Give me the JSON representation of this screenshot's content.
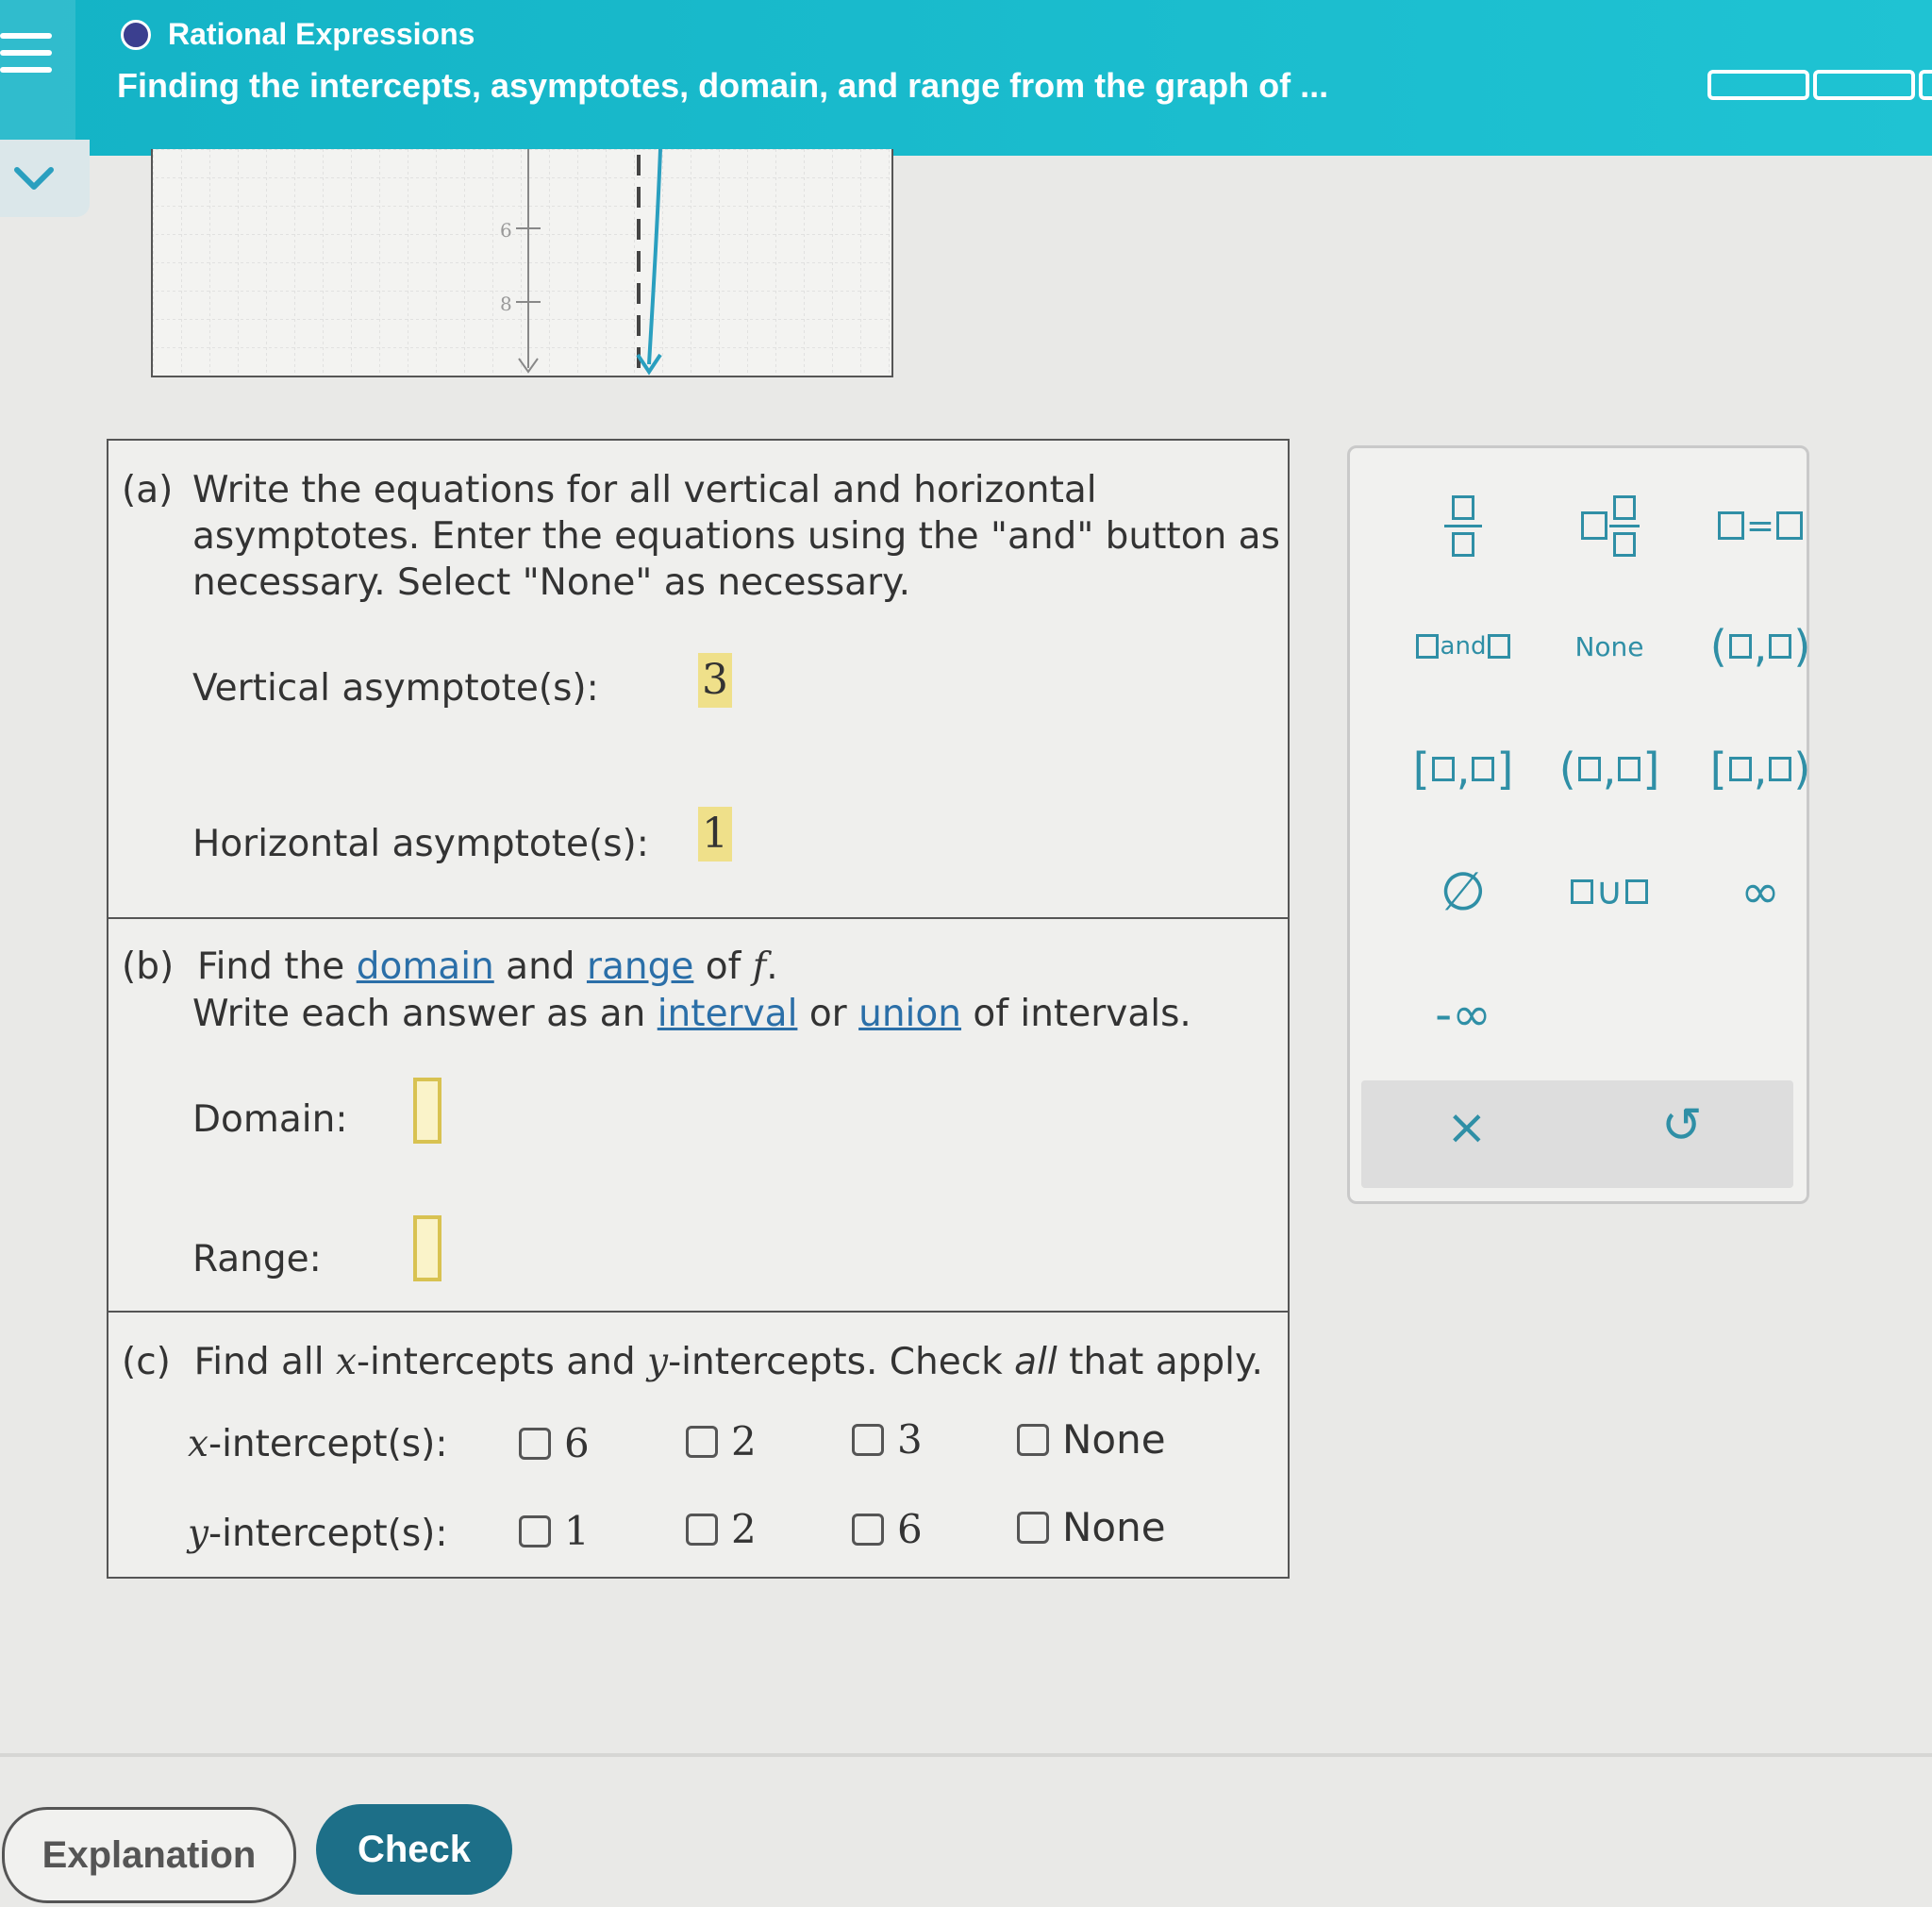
{
  "header": {
    "topic": "Rational Expressions",
    "title": "Finding the intercepts, asymptotes, domain, and range from the graph of ..."
  },
  "graph": {
    "y_tick_labels": [
      "6",
      "8"
    ]
  },
  "part_a": {
    "label": "(a)",
    "instructions_line1": "Write the equations for all vertical and horizontal",
    "instructions_line2": "asymptotes. Enter the equations using the \"and\" button as",
    "instructions_line3": "necessary. Select \"None\" as necessary.",
    "vertical_label": "Vertical asymptote(s):",
    "vertical_value": "3",
    "horizontal_label": "Horizontal asymptote(s):",
    "horizontal_value": "1"
  },
  "part_b": {
    "label": "(b)",
    "find_text": "Find the",
    "domain_link": "domain",
    "and_text": "and",
    "range_link": "range",
    "of_text": "of",
    "f_symbol": "f",
    "period": ".",
    "write_text": "Write each answer as an",
    "interval_link": "interval",
    "or_text": "or",
    "union_link": "union",
    "of_intervals": "of intervals.",
    "domain_label": "Domain:",
    "range_label": "Range:"
  },
  "part_c": {
    "label": "(c)",
    "instr_prefix": "Find all",
    "x_sym": "x",
    "instr_mid": "-intercepts and",
    "y_sym": "y",
    "instr_mid2": "-intercepts. Check",
    "all_word": "all",
    "instr_end": "that apply.",
    "x_row_suffix": "-intercept(s):",
    "y_row_suffix": "-intercept(s):",
    "x_options": [
      "6",
      "2",
      "3",
      "None"
    ],
    "y_options": [
      "1",
      "2",
      "6",
      "None"
    ]
  },
  "palette": {
    "and_text": "and",
    "none_text": "None",
    "empty_set": "∅",
    "union": "∪",
    "infinity": "∞",
    "neg_infinity": "-∞",
    "comma": ",",
    "equals": "=",
    "open_paren": "(",
    "close_paren": ")",
    "open_bracket": "[",
    "close_bracket": "]",
    "clear": "×",
    "undo": "↺"
  },
  "footer": {
    "explanation": "Explanation",
    "check": "Check"
  },
  "colors": {
    "header": "#1cbccd",
    "accent": "#2f8fa6",
    "check_button": "#1d6f88",
    "answer_highlight": "#efe08a"
  }
}
